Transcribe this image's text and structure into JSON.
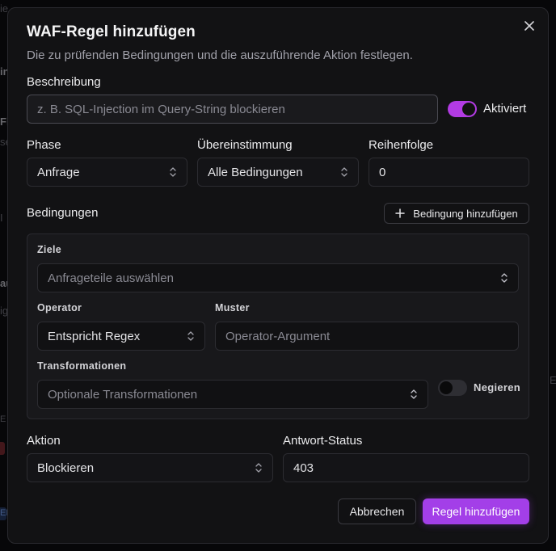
{
  "background": {
    "fragments": [
      "ie",
      "in",
      "Fi",
      "se",
      "I",
      "au",
      "ig",
      "E",
      "EI"
    ]
  },
  "dialog": {
    "title": "WAF-Regel hinzufügen",
    "subtitle": "Die zu prüfenden Bedingungen und die auszuführende Aktion festlegen.",
    "close_icon": "close-icon"
  },
  "description": {
    "label": "Beschreibung",
    "placeholder": "z. B. SQL-Injection im Query-String blockieren",
    "value": ""
  },
  "enabled_toggle": {
    "label": "Aktiviert",
    "on": true
  },
  "phase": {
    "label": "Phase",
    "value": "Anfrage"
  },
  "match": {
    "label": "Übereinstimmung",
    "value": "Alle Bedingungen"
  },
  "order": {
    "label": "Reihenfolge",
    "value": "0"
  },
  "conditions": {
    "label": "Bedingungen",
    "add_button": "Bedingung hinzufügen",
    "targets": {
      "label": "Ziele",
      "placeholder": "Anfrageteile auswählen"
    },
    "operator": {
      "label": "Operator",
      "value": "Entspricht Regex"
    },
    "pattern": {
      "label": "Muster",
      "placeholder": "Operator-Argument"
    },
    "transformations": {
      "label": "Transformationen",
      "placeholder": "Optionale Transformationen"
    },
    "negate": {
      "label": "Negieren",
      "on": false
    }
  },
  "action": {
    "label": "Aktion",
    "value": "Blockieren"
  },
  "response_status": {
    "label": "Antwort-Status",
    "value": "403"
  },
  "footer": {
    "cancel": "Abbrechen",
    "submit": "Regel hinzufügen"
  },
  "colors": {
    "accent": "#a33fe8",
    "toggle_on": "#b23be3",
    "background": "#121214"
  }
}
